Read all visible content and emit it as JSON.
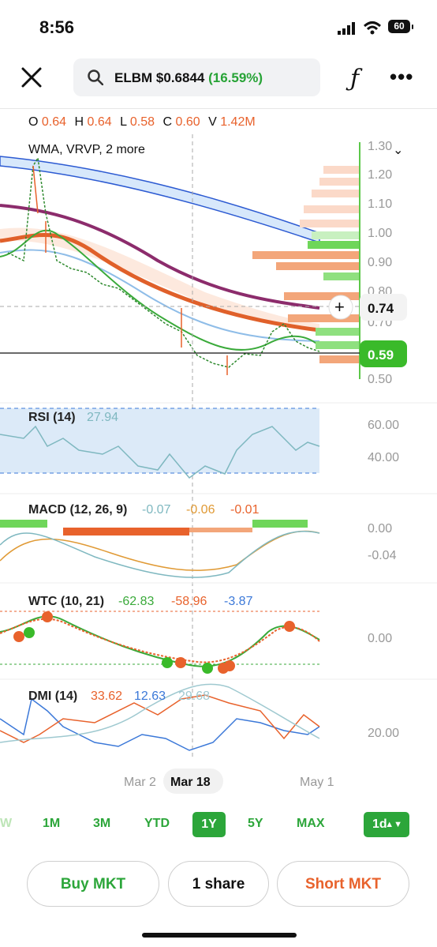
{
  "status_bar": {
    "time": "8:56",
    "battery": "60"
  },
  "header": {
    "ticker": "ELBM",
    "price": "$0.6844",
    "change": "(16.59%)"
  },
  "ohlcv": {
    "o_label": "O",
    "o": "0.64",
    "h_label": "H",
    "h": "0.64",
    "l_label": "L",
    "l": "0.58",
    "c_label": "C",
    "c": "0.60",
    "v_label": "V",
    "v": "1.42M"
  },
  "indicators_label": "WMA, VRVP, 2 more",
  "price_axis": [
    "1.30",
    "1.20",
    "1.10",
    "1.00",
    "0.90",
    "0.80",
    "0.70",
    "0.50"
  ],
  "crosshair_price": "0.74",
  "current_price": "0.59",
  "rsi": {
    "label": "RSI (14)",
    "value": "27.94",
    "ticks": [
      "60.00",
      "40.00"
    ]
  },
  "macd": {
    "label": "MACD (12, 26, 9)",
    "v1": "-0.07",
    "v2": "-0.06",
    "v3": "-0.01",
    "ticks": [
      "0.00",
      "-0.04"
    ]
  },
  "wtc": {
    "label": "WTC (10, 21)",
    "v1": "-62.83",
    "v2": "-58.96",
    "v3": "-3.87",
    "ticks": [
      "0.00"
    ]
  },
  "dmi": {
    "label": "DMI (14)",
    "v1": "33.62",
    "v2": "12.63",
    "v3": "29.68",
    "ticks": [
      "20.00"
    ]
  },
  "x_axis": {
    "left": "Mar 2",
    "center": "Mar 18",
    "right": "May 1"
  },
  "timeframes": [
    "W",
    "1M",
    "3M",
    "YTD",
    "1Y",
    "5Y",
    "MAX"
  ],
  "selected_timeframe": "1Y",
  "interval": "1d",
  "actions": {
    "buy": "Buy MKT",
    "quantity": "1 share",
    "short": "Short MKT"
  },
  "colors": {
    "green": "#2ca63a",
    "orange": "#e8622c",
    "blue": "#3b78d8"
  }
}
